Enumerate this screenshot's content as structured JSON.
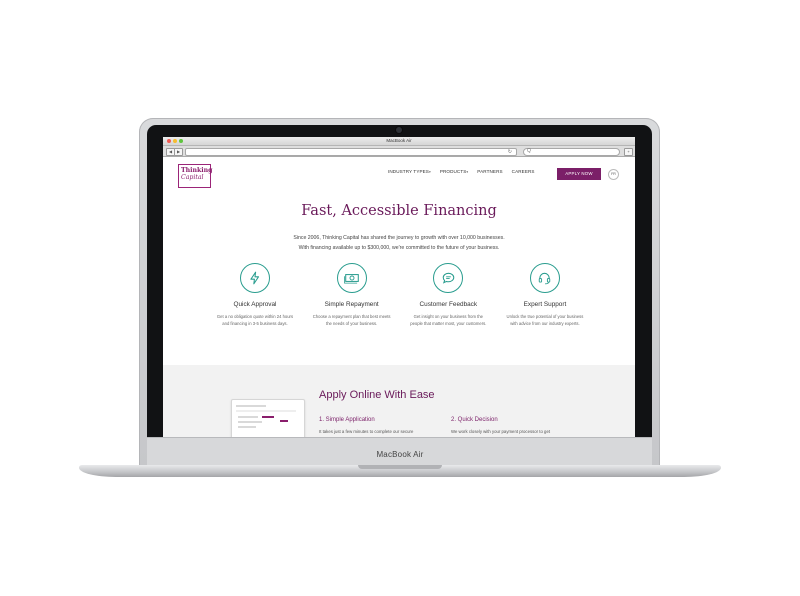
{
  "laptop": {
    "model_label": "MacBook Air"
  },
  "browser": {
    "window_title": "MacBook Air",
    "back": "◀",
    "forward": "▶",
    "reload": "↻",
    "search_glyph": "Q",
    "sidebar_glyph": "+"
  },
  "site": {
    "logo": {
      "line1": "Thinking",
      "line2": "Capital"
    },
    "nav": [
      {
        "label": "INDUSTRY TYPES",
        "has_caret": true
      },
      {
        "label": "PRODUCTS",
        "has_caret": true
      },
      {
        "label": "PARTNERS",
        "has_caret": false
      },
      {
        "label": "CAREERS",
        "has_caret": false
      }
    ],
    "caret": "▾",
    "apply_label": "APPLY NOW",
    "lang_label": "FR",
    "hero": {
      "title": "Fast, Accessible Financing",
      "line1": "Since 2006, Thinking Capital has shared the journey to growth with over 10,000 businesses.",
      "line2": "With financing available up to $300,000, we're committed to the future of your business."
    },
    "features": [
      {
        "icon": "lightning-icon",
        "title": "Quick Approval",
        "desc": "Get a no obligation quote within 24 hours and financing in 3-5 business days."
      },
      {
        "icon": "money-icon",
        "title": "Simple Repayment",
        "desc": "Choose a repayment plan that best meets the needs of your business."
      },
      {
        "icon": "chat-icon",
        "title": "Customer Feedback",
        "desc": "Get insight on your business from the people that matter most, your customers."
      },
      {
        "icon": "headset-icon",
        "title": "Expert Support",
        "desc": "Unlock the true potential of your business with advice from our industry experts."
      }
    ],
    "apply_section": {
      "title": "Apply Online With Ease",
      "step1_title": "1. Simple Application",
      "step1_desc": "It takes just a few minutes to complete our secure",
      "step2_title": "2. Quick Decision",
      "step2_desc": "We work closely with your payment processor to get"
    }
  },
  "colors": {
    "brand": "#7b1f68",
    "teal": "#2a9d8f"
  }
}
